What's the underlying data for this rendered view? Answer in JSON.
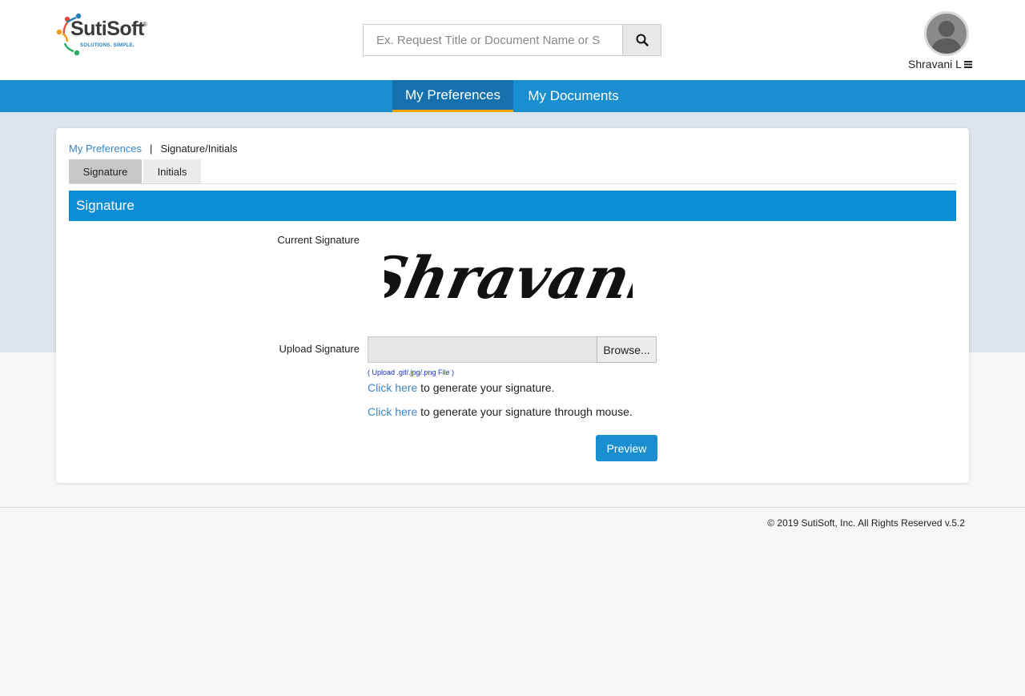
{
  "header": {
    "logo": {
      "brand": "SutiSoft",
      "registered": "®",
      "tagline": "SOLUTIONS. SIMPLE."
    },
    "search": {
      "placeholder": "Ex. Request Title or Document Name or S"
    },
    "user": {
      "name": "Shravani L",
      "menu_icon": "hamburger-icon"
    }
  },
  "nav": {
    "tabs": [
      {
        "label": "My Preferences",
        "active": true
      },
      {
        "label": "My Documents",
        "active": false
      }
    ]
  },
  "breadcrumb": {
    "link": "My Preferences",
    "separator": "|",
    "current": "Signature/Initials"
  },
  "tabs": [
    {
      "label": "Signature",
      "active": true
    },
    {
      "label": "Initials",
      "active": false
    }
  ],
  "section": {
    "title": "Signature"
  },
  "form": {
    "current_label": "Current Signature",
    "signature_text": "Shravani",
    "upload_label": "Upload Signature",
    "browse_label": "Browse...",
    "hint": "( Upload .gif/.jpg/.png File )",
    "generate_link": "Click here",
    "generate_text": " to generate your signature.",
    "mouse_link": "Click here",
    "mouse_text": " to generate your signature through mouse.",
    "preview_label": "Preview"
  },
  "footer": {
    "text": "© 2019 SutiSoft, Inc. All Rights Reserved v.5.2"
  },
  "colors": {
    "nav_bg": "#1a8fcf",
    "nav_active": "#1471ad",
    "active_underline": "#f0a500",
    "section_bar": "#0b8dd6",
    "link": "#3a86c8"
  }
}
